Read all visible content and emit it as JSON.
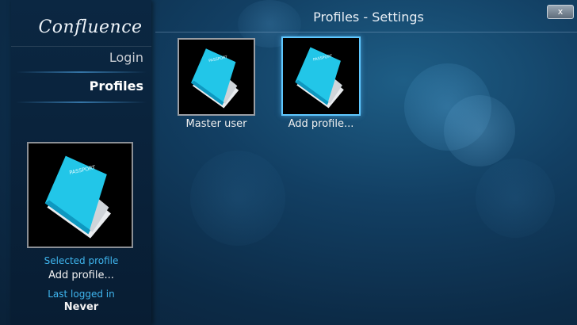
{
  "window": {
    "title": "Profiles - Settings",
    "close_glyph": "x"
  },
  "sidebar": {
    "logo": "Confluence",
    "menu": [
      {
        "label": "Login"
      },
      {
        "label": "Profiles"
      }
    ]
  },
  "profiles": [
    {
      "name": "Master user",
      "icon": "passport-icon"
    },
    {
      "name": "Add profile...",
      "icon": "passport-icon"
    }
  ],
  "selected_profile": {
    "label": "Selected profile",
    "name": "Add profile...",
    "last_logged_label": "Last logged in",
    "last_logged_value": "Never"
  },
  "passport_text": "PASSPORT",
  "colors": {
    "accent": "#3fb6ef",
    "passport_cover": "#22c6e8",
    "background": "#123f63"
  }
}
